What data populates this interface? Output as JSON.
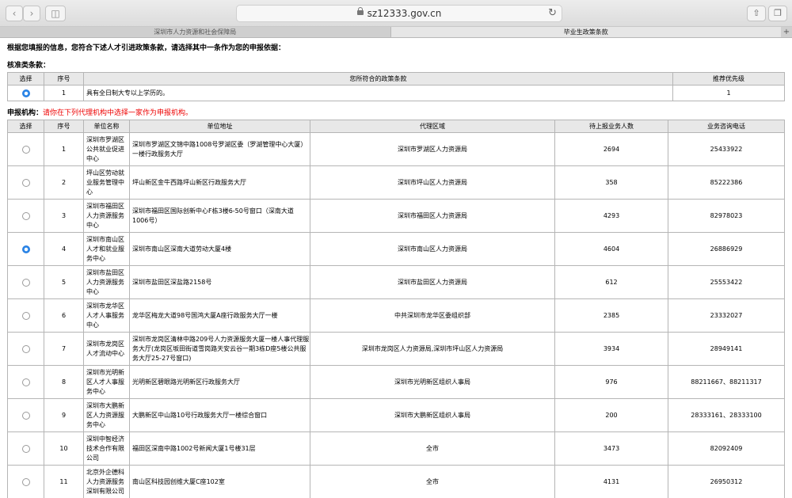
{
  "browser": {
    "url": "sz12333.gov.cn",
    "tabs": [
      {
        "label": "深圳市人力资源和社会保障局",
        "active": false
      },
      {
        "label": "毕业生政策条款",
        "active": true
      }
    ],
    "icons": {
      "back": "chevron-left-icon",
      "forward": "chevron-right-icon",
      "sidebar": "sidebar-icon",
      "lock": "lock-icon",
      "reload": "reload-icon",
      "share": "share-icon",
      "tabs": "tabs-icon",
      "new_tab": "plus-icon"
    }
  },
  "intro": "根据您填报的信息，您符合下述人才引进政策条款，请选择其中一条作为您的申报依据：",
  "policy_section": {
    "title": "核准类条款：",
    "headers": [
      "选择",
      "序号",
      "您所符合的政策条款",
      "推荐优先级"
    ],
    "rows": [
      {
        "selected": true,
        "index": "1",
        "clause": "具有全日制大专以上学历的。",
        "priority": "1"
      }
    ]
  },
  "agency_section": {
    "title": "申报机构：",
    "warning": "请你在下列代理机构中选择一家作为申报机构。",
    "headers": [
      "选择",
      "序号",
      "单位名称",
      "单位地址",
      "代理区域",
      "待上报业务人数",
      "业务咨询电话"
    ],
    "rows": [
      {
        "selected": false,
        "index": "1",
        "name": "深圳市罗湖区公共就业促进中心",
        "address": "深圳市罗湖区文锦中路1008号罗湖区委（罗湖管理中心大厦）一楼行政服务大厅",
        "region": "深圳市罗湖区人力资源局",
        "count": "2694",
        "phone": "25433922"
      },
      {
        "selected": false,
        "index": "2",
        "name": "坪山区劳动就业服务管理中心",
        "address": "坪山新区金牛西路坪山新区行政服务大厅",
        "region": "深圳市坪山区人力资源局",
        "count": "358",
        "phone": "85222386"
      },
      {
        "selected": false,
        "index": "3",
        "name": "深圳市福田区人力资源服务中心",
        "address": "深圳市福田区国际创新中心F栋3楼6-50号窗口（深南大道1006号）",
        "region": "深圳市福田区人力资源局",
        "count": "4293",
        "phone": "82978023"
      },
      {
        "selected": true,
        "index": "4",
        "name": "深圳市南山区人才和就业服务中心",
        "address": "深圳市南山区深南大道劳动大厦4楼",
        "region": "深圳市南山区人力资源局",
        "count": "4604",
        "phone": "26886929"
      },
      {
        "selected": false,
        "index": "5",
        "name": "深圳市盐田区人力资源服务中心",
        "address": "深圳市盐田区深盐路2158号",
        "region": "深圳市盐田区人力资源局",
        "count": "612",
        "phone": "25553422"
      },
      {
        "selected": false,
        "index": "6",
        "name": "深圳市龙华区人才人事服务中心",
        "address": "龙华区梅龙大道98号国鸿大厦A座行政服务大厅一楼",
        "region": "中共深圳市龙华区委组织部",
        "count": "2385",
        "phone": "23332027"
      },
      {
        "selected": false,
        "index": "7",
        "name": "深圳市龙岗区人才流动中心",
        "address": "深圳市龙岗区清林中路209号人力资源服务大厦一楼人事代理服务大厅(龙岗区坂田街道雪岗路天安云谷一期3栋D座5楼公共服务大厅25-27号窗口)",
        "region": "深圳市龙岗区人力资源局,深圳市坪山区人力资源局",
        "count": "3934",
        "phone": "28949141"
      },
      {
        "selected": false,
        "index": "8",
        "name": "深圳市光明新区人才人事服务中心",
        "address": "光明新区碧眼路光明新区行政服务大厅",
        "region": "深圳市光明新区组织人事局",
        "count": "976",
        "phone": "88211667、88211317"
      },
      {
        "selected": false,
        "index": "9",
        "name": "深圳市大鹏新区人力资源服务中心",
        "address": "大鹏新区中山路10号行政服务大厅一楼综合窗口",
        "region": "深圳市大鹏新区组织人事局",
        "count": "200",
        "phone": "28333161、28333100"
      },
      {
        "selected": false,
        "index": "10",
        "name": "深圳中智经济技术合作有限公司",
        "address": "福田区深南中路1002号新闻大厦1号楼31层",
        "region": "全市",
        "count": "3473",
        "phone": "82092409"
      },
      {
        "selected": false,
        "index": "11",
        "name": "北京外企德科人力资源服务深圳有限公司",
        "address": "南山区科技园创维大厦C座102室",
        "region": "全市",
        "count": "4131",
        "phone": "26950312"
      }
    ]
  }
}
